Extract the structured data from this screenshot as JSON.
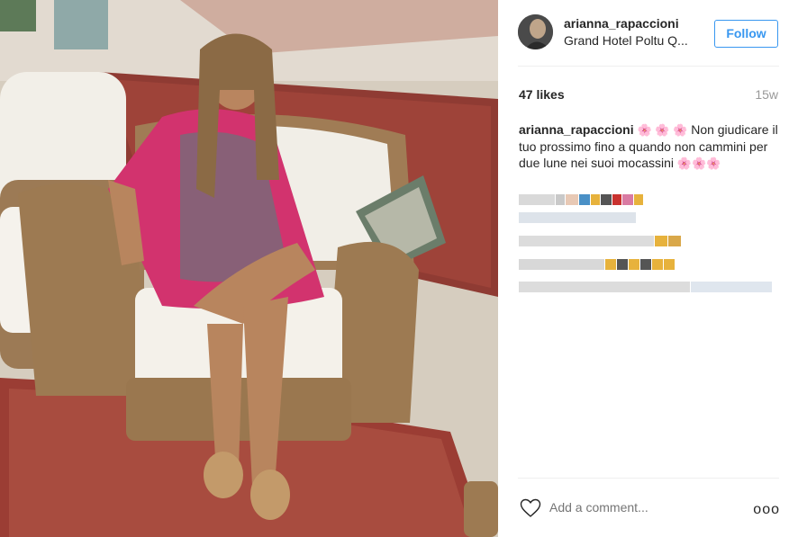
{
  "post": {
    "username": "arianna_rapaccioni",
    "location": "Grand Hotel Poltu Q...",
    "follow_label": "Follow",
    "likes": "47 likes",
    "time": "15w",
    "caption_user": "arianna_rapaccioni",
    "caption_flowers_1": "🌸 🌸 🌸",
    "caption_text": "Non giudicare il tuo prossimo fino a quando non cammini per due lune nei suoi mocassini",
    "caption_flowers_2": "🌸🌸🌸",
    "add_comment_placeholder": "Add a comment...",
    "more_label": "ooo"
  },
  "icons": {
    "heart": "heart-icon",
    "more": "more-options-icon",
    "avatar": "avatar"
  },
  "colors": {
    "accent": "#3897f0",
    "text": "#262626",
    "muted": "#999999"
  }
}
